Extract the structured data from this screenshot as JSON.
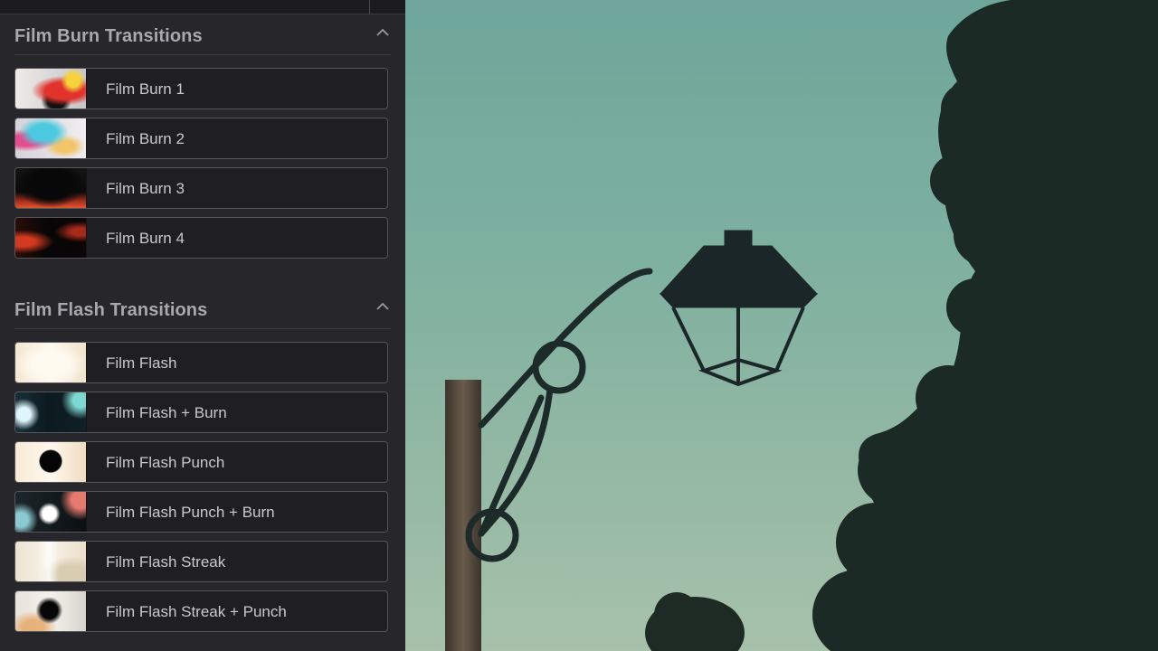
{
  "sections": [
    {
      "title": "Film Burn Transitions",
      "items": [
        {
          "label": "Film Burn 1"
        },
        {
          "label": "Film Burn 2"
        },
        {
          "label": "Film Burn 3"
        },
        {
          "label": "Film Burn 4"
        }
      ]
    },
    {
      "title": "Film Flash Transitions",
      "items": [
        {
          "label": "Film Flash"
        },
        {
          "label": "Film Flash + Burn"
        },
        {
          "label": "Film Flash Punch"
        },
        {
          "label": "Film Flash Punch + Burn"
        },
        {
          "label": "Film Flash Streak"
        },
        {
          "label": "Film Flash Streak + Punch"
        }
      ]
    }
  ],
  "icons": {
    "collapse": "chevron-up-icon"
  },
  "colors": {
    "panel_bg": "#26262b",
    "item_bg": "#1f1f23",
    "item_border": "#55555c",
    "title_text": "#a8a8ae",
    "item_text": "#c9c9cd"
  }
}
